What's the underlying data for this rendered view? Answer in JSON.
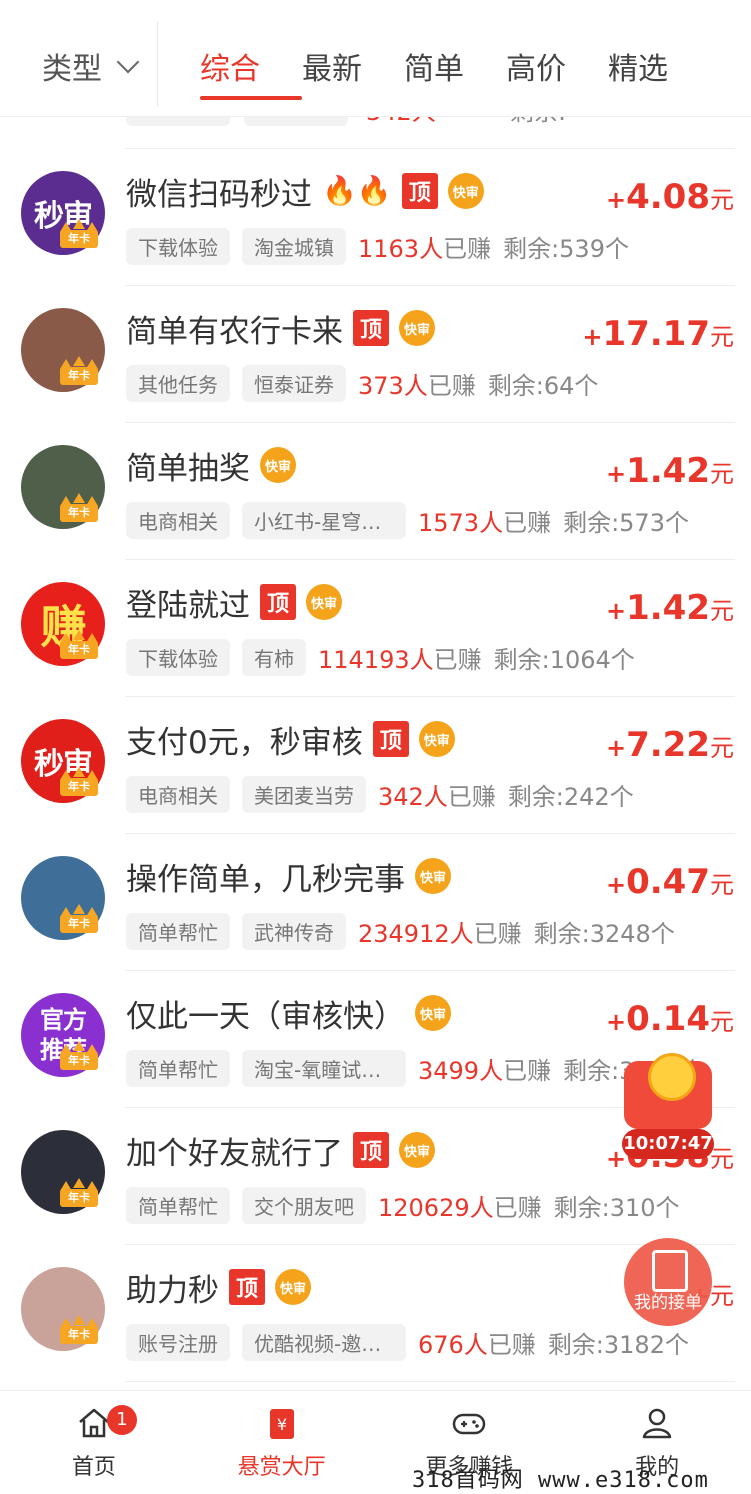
{
  "header": {
    "type_label": "类型",
    "tabs": [
      {
        "label": "综合",
        "active": true
      },
      {
        "label": "最新",
        "active": false
      },
      {
        "label": "简单",
        "active": false
      },
      {
        "label": "高价",
        "active": false
      },
      {
        "label": "精选",
        "active": false
      }
    ]
  },
  "partial_row": {
    "earned_num": "342人",
    "remain": "剩余:"
  },
  "tasks": [
    {
      "title": "微信扫码秒过",
      "fire": "🔥🔥",
      "top": true,
      "fast": true,
      "reward_sign": "+",
      "reward": "4.08",
      "unit": "元",
      "tags": [
        "下载体验",
        "淘金城镇"
      ],
      "earned_num": "1163人",
      "earned_suffix": "已赚",
      "remain": "剩余:539个",
      "avatar_text": "秒审",
      "avatar_color": "#5b2d91"
    },
    {
      "title": "简单有农行卡来",
      "fire": "",
      "top": true,
      "fast": true,
      "reward_sign": "+",
      "reward": "17.17",
      "unit": "元",
      "tags": [
        "其他任务",
        "恒泰证券"
      ],
      "earned_num": "373人",
      "earned_suffix": "已赚",
      "remain": "剩余:64个",
      "avatar_text": "",
      "avatar_color": "#8a5a48"
    },
    {
      "title": "简单抽奖",
      "fire": "",
      "top": false,
      "fast": true,
      "reward_sign": "+",
      "reward": "1.42",
      "unit": "元",
      "tags": [
        "电商相关",
        "小红书-星穹铁..."
      ],
      "earned_num": "1573人",
      "earned_suffix": "已赚",
      "remain": "剩余:573个",
      "avatar_text": "",
      "avatar_color": "#4f5f4a"
    },
    {
      "title": "登陆就过",
      "fire": "",
      "top": true,
      "fast": true,
      "reward_sign": "+",
      "reward": "1.42",
      "unit": "元",
      "tags": [
        "下载体验",
        "有柿"
      ],
      "earned_num": "114193人",
      "earned_suffix": "已赚",
      "remain": "剩余:1064个",
      "avatar_text": "赚",
      "avatar_color": "#e8201b"
    },
    {
      "title": "支付0元，秒审核",
      "fire": "",
      "top": true,
      "fast": true,
      "reward_sign": "+",
      "reward": "7.22",
      "unit": "元",
      "tags": [
        "电商相关",
        "美团麦当劳"
      ],
      "earned_num": "342人",
      "earned_suffix": "已赚",
      "remain": "剩余:242个",
      "avatar_text": "秒审",
      "avatar_color": "#e01e1a"
    },
    {
      "title": "操作简单，几秒完事",
      "fire": "",
      "top": false,
      "fast": true,
      "reward_sign": "+",
      "reward": "0.47",
      "unit": "元",
      "tags": [
        "简单帮忙",
        "武神传奇"
      ],
      "earned_num": "234912人",
      "earned_suffix": "已赚",
      "remain": "剩余:3248个",
      "avatar_text": "",
      "avatar_color": "#3f6f98"
    },
    {
      "title": "仅此一天（审核快）",
      "fire": "",
      "top": false,
      "fast": true,
      "reward_sign": "+",
      "reward": "0.14",
      "unit": "元",
      "tags": [
        "简单帮忙",
        "淘宝-氧瞳试戴..."
      ],
      "earned_num": "3499人",
      "earned_suffix": "已赚",
      "remain": "剩余:3172个",
      "avatar_text": "官方推荐",
      "avatar_color": "#8a2fd0"
    },
    {
      "title": "加个好友就行了",
      "fire": "",
      "top": true,
      "fast": true,
      "reward_sign": "+",
      "reward": "0.58",
      "unit": "元",
      "tags": [
        "简单帮忙",
        "交个朋友吧"
      ],
      "earned_num": "120629人",
      "earned_suffix": "已赚",
      "remain": "剩余:310个",
      "avatar_text": "",
      "avatar_color": "#2c2f3a"
    },
    {
      "title": "助力秒",
      "fire": "",
      "top": true,
      "fast": true,
      "reward_sign": "+",
      "reward": "",
      "unit": "元",
      "tags": [
        "账号注册",
        "优酷视频-邀好..."
      ],
      "earned_num": "676人",
      "earned_suffix": "已赚",
      "remain": "剩余:3182个",
      "avatar_text": "",
      "avatar_color": "#c9a39a"
    }
  ],
  "badges": {
    "top": "顶",
    "fast": "快审",
    "crown": "年卡"
  },
  "floating": {
    "timer": "10:07:47",
    "my_tasks": "我的接单"
  },
  "nav": [
    {
      "label": "首页",
      "icon": "home-icon",
      "badge": "1"
    },
    {
      "label": "悬赏大厅",
      "icon": "reward-hall-icon",
      "badge": ""
    },
    {
      "label": "更多赚钱",
      "icon": "gamepad-icon",
      "badge": ""
    },
    {
      "label": "我的",
      "icon": "user-icon",
      "badge": ""
    }
  ],
  "watermark": "318首码网  www.e318.com",
  "colors": {
    "accent": "#e8362b",
    "fast": "#f5a31a"
  }
}
